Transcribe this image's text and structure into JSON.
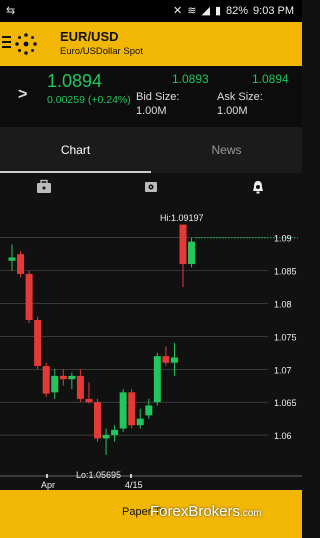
{
  "status_bar": {
    "notif_left": "⇆",
    "battery": "82%",
    "time": "9:03 PM"
  },
  "header": {
    "symbol": "EUR/USD",
    "description": "Euro/USDollar Spot"
  },
  "quote": {
    "last": "1.0894",
    "change": "0.00259 (+0.24%)",
    "bid": "1.0893",
    "ask": "1.0894",
    "bid_size_label": "Bid Size:",
    "bid_size": "1.00M",
    "ask_size_label": "Ask Size:",
    "ask_size": "1.00M"
  },
  "tabs": [
    {
      "label": "Chart"
    },
    {
      "label": "News"
    }
  ],
  "footer": {
    "text": "Paper Tr",
    "watermark": "ForexBrokers",
    "watermark_suffix": ".com"
  },
  "colors": {
    "accent": "#f2b705",
    "up": "#22c55e",
    "down": "#e53935"
  },
  "chart_data": {
    "type": "candlestick",
    "ylim": [
      1.055,
      1.093
    ],
    "yticks": [
      "1.09",
      "1.085",
      "1.08",
      "1.075",
      "1.07",
      "1.065",
      "1.06"
    ],
    "xticks": [
      "Apr",
      "4/15"
    ],
    "annotations": {
      "high": "Hi:1.09197",
      "low": "Lo:1.05695",
      "last_marker": "1.09"
    },
    "candles": [
      {
        "o": 1.0865,
        "h": 1.089,
        "l": 1.085,
        "c": 1.087
      },
      {
        "o": 1.0875,
        "h": 1.088,
        "l": 1.084,
        "c": 1.0845
      },
      {
        "o": 1.0845,
        "h": 1.085,
        "l": 1.077,
        "c": 1.0775
      },
      {
        "o": 1.0775,
        "h": 1.078,
        "l": 1.07,
        "c": 1.0705
      },
      {
        "o": 1.0705,
        "h": 1.071,
        "l": 1.0658,
        "c": 1.0663
      },
      {
        "o": 1.0665,
        "h": 1.07,
        "l": 1.0655,
        "c": 1.069
      },
      {
        "o": 1.069,
        "h": 1.07,
        "l": 1.0675,
        "c": 1.0685
      },
      {
        "o": 1.0685,
        "h": 1.0695,
        "l": 1.067,
        "c": 1.069
      },
      {
        "o": 1.069,
        "h": 1.07,
        "l": 1.065,
        "c": 1.0655
      },
      {
        "o": 1.0655,
        "h": 1.068,
        "l": 1.0648,
        "c": 1.065
      },
      {
        "o": 1.065,
        "h": 1.0655,
        "l": 1.059,
        "c": 1.0595
      },
      {
        "o": 1.0595,
        "h": 1.061,
        "l": 1.057,
        "c": 1.06
      },
      {
        "o": 1.06,
        "h": 1.0615,
        "l": 1.059,
        "c": 1.0608
      },
      {
        "o": 1.061,
        "h": 1.067,
        "l": 1.0605,
        "c": 1.0665
      },
      {
        "o": 1.0665,
        "h": 1.067,
        "l": 1.061,
        "c": 1.0615
      },
      {
        "o": 1.0615,
        "h": 1.064,
        "l": 1.061,
        "c": 1.0625
      },
      {
        "o": 1.063,
        "h": 1.0655,
        "l": 1.0625,
        "c": 1.0645
      },
      {
        "o": 1.065,
        "h": 1.0725,
        "l": 1.0645,
        "c": 1.072
      },
      {
        "o": 1.072,
        "h": 1.0735,
        "l": 1.0705,
        "c": 1.071
      },
      {
        "o": 1.071,
        "h": 1.074,
        "l": 1.069,
        "c": 1.0718
      },
      {
        "o": 1.092,
        "h": 1.092,
        "l": 1.0825,
        "c": 1.086
      },
      {
        "o": 1.086,
        "h": 1.09,
        "l": 1.0855,
        "c": 1.0894
      }
    ]
  }
}
